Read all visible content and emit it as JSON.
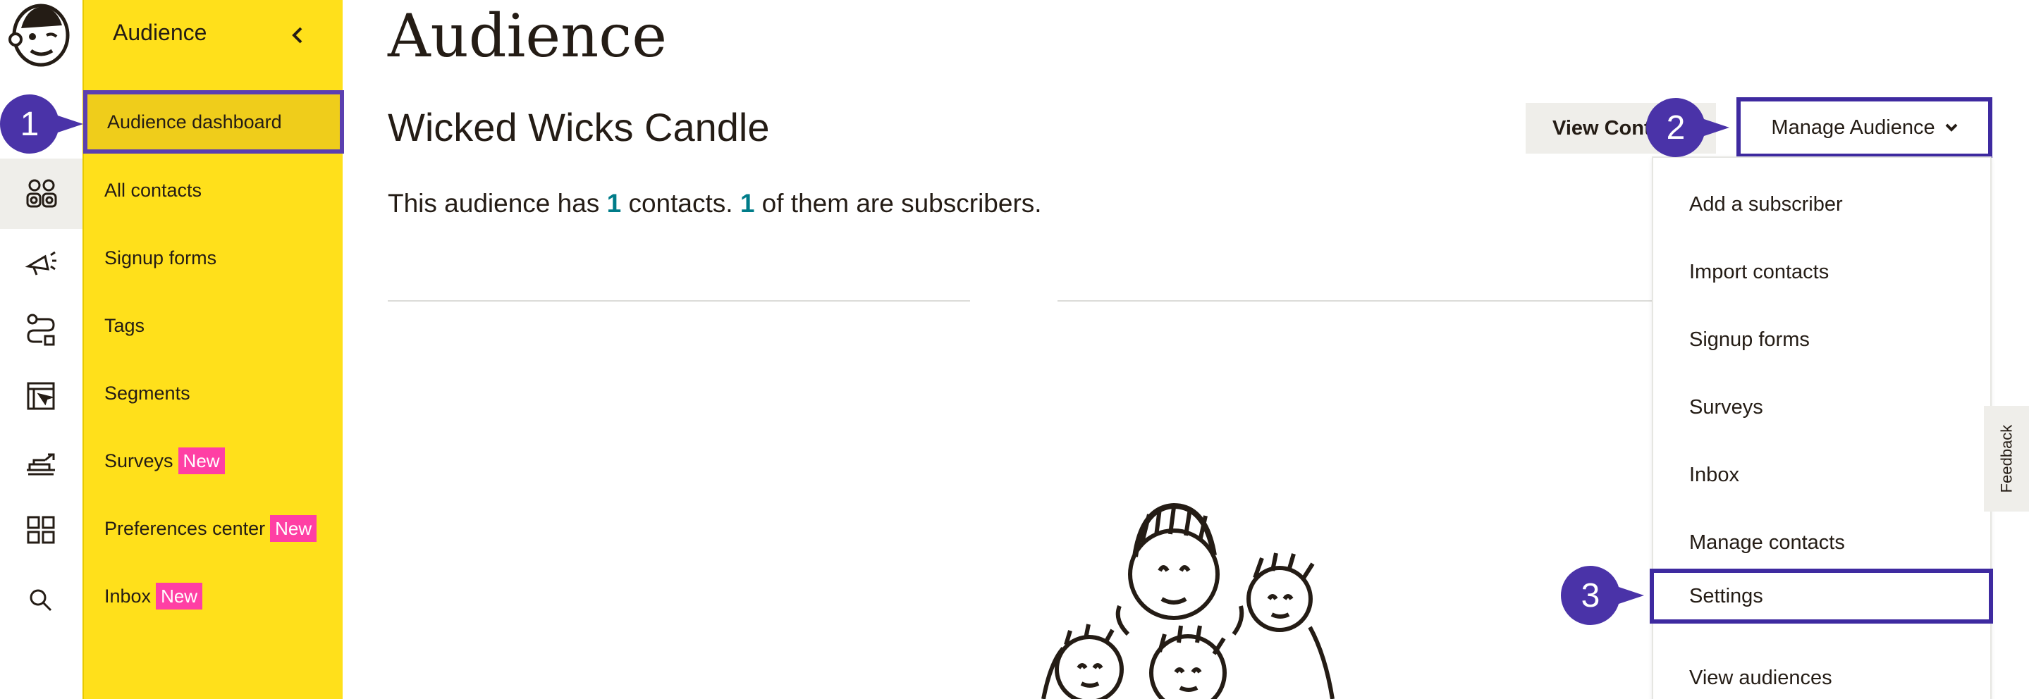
{
  "rail": {
    "icons": [
      "mailchimp-logo",
      "audience-icon",
      "campaigns-icon",
      "automations-icon",
      "website-icon",
      "integrations-icon",
      "apps-icon",
      "search-icon"
    ]
  },
  "sidebar": {
    "title": "Audience",
    "items": [
      {
        "label": "Audience dashboard",
        "badge": ""
      },
      {
        "label": "All contacts",
        "badge": ""
      },
      {
        "label": "Signup forms",
        "badge": ""
      },
      {
        "label": "Tags",
        "badge": ""
      },
      {
        "label": "Segments",
        "badge": ""
      },
      {
        "label": "Surveys",
        "badge": "New"
      },
      {
        "label": "Preferences center",
        "badge": "New"
      },
      {
        "label": "Inbox",
        "badge": "New"
      }
    ]
  },
  "main": {
    "title": "Audience",
    "audience_name": "Wicked Wicks Candle",
    "summary": {
      "prefix": "This audience has ",
      "contacts": "1",
      "middle": " contacts. ",
      "subscribers": "1",
      "suffix": " of them are subscribers."
    },
    "view_button": "View Contacts",
    "manage_button": "Manage Audience"
  },
  "menu": {
    "items": [
      "Add a subscriber",
      "Import contacts",
      "Signup forms",
      "Surveys",
      "Inbox",
      "Manage contacts",
      "Settings",
      "View audiences"
    ]
  },
  "feedback_label": "Feedback",
  "callouts": [
    "1",
    "2",
    "3"
  ],
  "colors": {
    "sidebar": "#ffe01b",
    "highlight": "#3e2aa0",
    "callout": "#4a33a8",
    "teal": "#007c89",
    "badge": "#ff3fa4"
  }
}
